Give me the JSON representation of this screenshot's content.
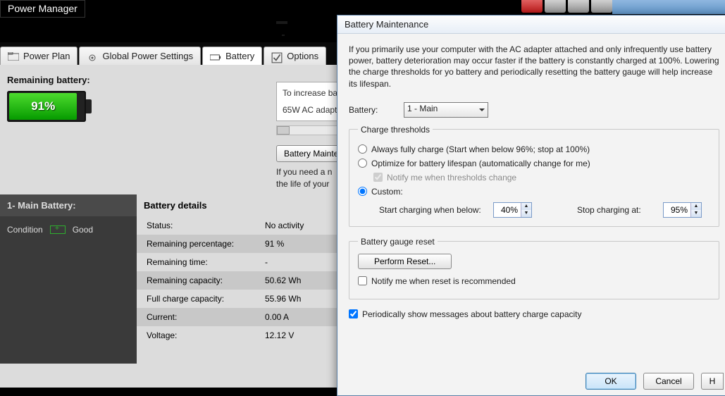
{
  "app": {
    "title": "Power Manager"
  },
  "tabs": {
    "items": [
      {
        "label": "Power Plan"
      },
      {
        "label": "Global Power Settings"
      },
      {
        "label": "Battery"
      },
      {
        "label": "Options"
      }
    ],
    "activeIndex": 2
  },
  "remaining": {
    "label": "Remaining battery:",
    "percentText": "91%",
    "fillPercent": 91
  },
  "tipBox": {
    "line1": "To increase ba",
    "line2": "65W AC adapt"
  },
  "maintButton": "Battery Mainte",
  "needText": "If you need a n\nthe life of your",
  "sidebar": {
    "header": "1- Main Battery:",
    "conditionLabel": "Condition",
    "conditionValue": "Good"
  },
  "details": {
    "header": "Battery details",
    "rows": [
      {
        "k": "Status:",
        "v": "No activity"
      },
      {
        "k": "Remaining percentage:",
        "v": "91 %"
      },
      {
        "k": "Remaining time:",
        "v": "-"
      },
      {
        "k": "Remaining capacity:",
        "v": "50.62 Wh"
      },
      {
        "k": "Full charge capacity:",
        "v": "55.96 Wh"
      },
      {
        "k": "Current:",
        "v": "0.00 A"
      },
      {
        "k": "Voltage:",
        "v": "12.12 V"
      }
    ]
  },
  "dialog": {
    "title": "Battery Maintenance",
    "intro": "If you primarily use your computer with the AC adapter attached and only infrequently use battery power, battery deterioration may occur faster if the battery is constantly charged at 100%. Lowering the charge thresholds for yo battery and periodically resetting the battery gauge will help increase its lifespan.",
    "batteryLabel": "Battery:",
    "batterySelect": "1 - Main",
    "thresholds": {
      "legend": "Charge thresholds",
      "opt1": "Always fully charge (Start when below 96%; stop at 100%)",
      "opt2": "Optimize for battery lifespan (automatically change for me)",
      "notify": "Notify me when thresholds change",
      "opt3": "Custom:",
      "startLabel": "Start charging when below:",
      "startValue": "40%",
      "stopLabel": "Stop charging at:",
      "stopValue": "95%"
    },
    "gauge": {
      "legend": "Battery gauge reset",
      "reset": "Perform Reset...",
      "notify": "Notify me when reset is recommended"
    },
    "periodic": "Periodically show messages about battery charge capacity",
    "ok": "OK",
    "cancel": "Cancel",
    "help": "H"
  }
}
